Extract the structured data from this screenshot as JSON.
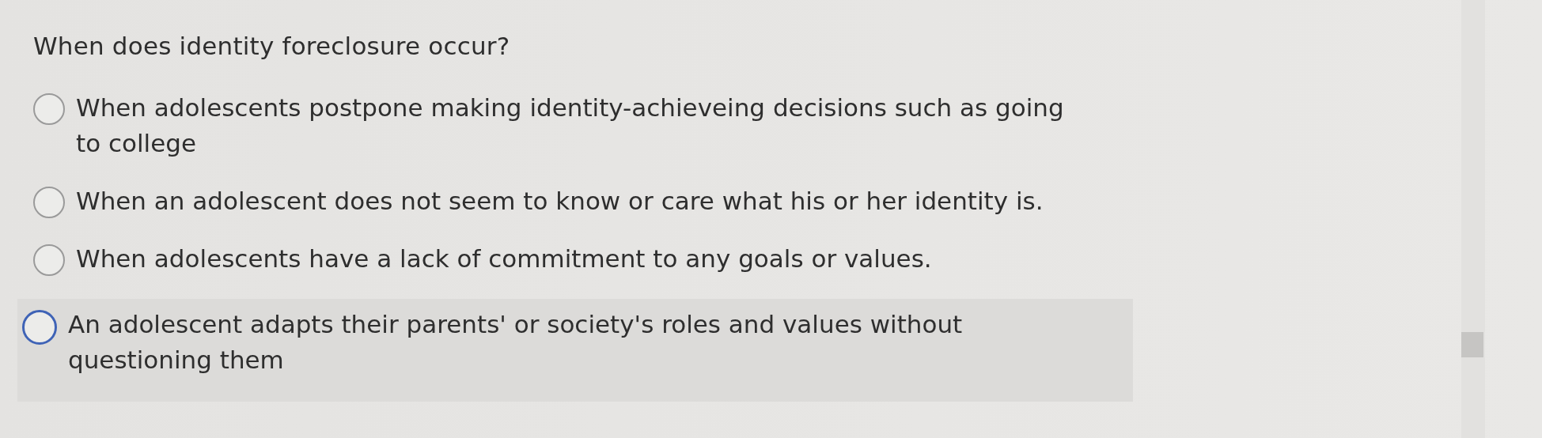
{
  "question": "When does identity foreclosure occur?",
  "options": [
    {
      "label": "When adolescents postpone making identity-achieveing decisions such as going to college",
      "selected": false,
      "focused": false
    },
    {
      "label": "When an adolescent does not seem to know or care what his or her identity is.",
      "selected": false,
      "focused": false
    },
    {
      "label": "When adolescents have a lack of commitment to any goals or values.",
      "selected": false,
      "focused": false
    },
    {
      "label": "An adolescent adapts their parents' or society's roles and values without questioning them",
      "selected": false,
      "focused": true
    }
  ]
}
